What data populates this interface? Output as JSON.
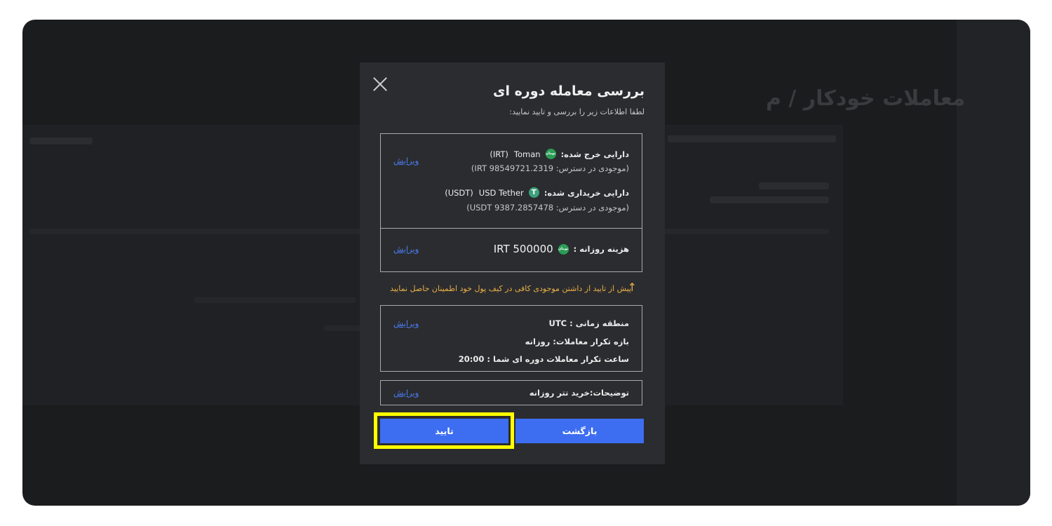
{
  "background": {
    "page_title": "معاملات خودکار / م"
  },
  "modal": {
    "title": "بررسی معامله دوره ای",
    "subtitle": "لطفا اطلاعات زیر را بررسی و تایید نمایید:",
    "assets": {
      "spent_label": "دارایی خرج شده:",
      "spent_coin_icon": "toman-coin-icon",
      "spent_coin_text": "تومان",
      "spent_name": "Toman",
      "spent_code": "(IRT)",
      "spent_available": "(موجودی در دسترس: IRT 98549721.2319)",
      "bought_label": "دارایی خریداری شده:",
      "bought_coin_icon": "tether-coin-icon",
      "bought_coin_text": "T",
      "bought_name": "USD Tether",
      "bought_code": "(USDT)",
      "bought_available": "(موجودی در دسترس: USDT 9387.2857478)",
      "edit_label": "ویرایش"
    },
    "daily_cost": {
      "label": "هزینه روزانه :",
      "coin_text": "تومان",
      "value": "IRT 500000",
      "edit_label": "ویرایش"
    },
    "warning": {
      "text": "پیش از تایید از داشتن موجودی کافی در کیف پول خود اطمینان حاصل نمایید",
      "icon": "arrow-up-icon"
    },
    "schedule": {
      "timezone": "منطقه زمانی : UTC",
      "frequency": "بازه تکرار معاملات: روزانه",
      "time": "ساعت تکرار معاملات دوره ای شما : 20:00",
      "edit_label": "ویرایش"
    },
    "description": {
      "text": "توضیحات:خرید تتر روزانه",
      "edit_label": "ویرایش"
    },
    "buttons": {
      "back": "بازگشت",
      "confirm": "تایید"
    }
  },
  "colors": {
    "accent": "#3d6ef1",
    "link": "#4b7cf5",
    "warning": "#e9b048",
    "highlight": "#ffff00"
  }
}
